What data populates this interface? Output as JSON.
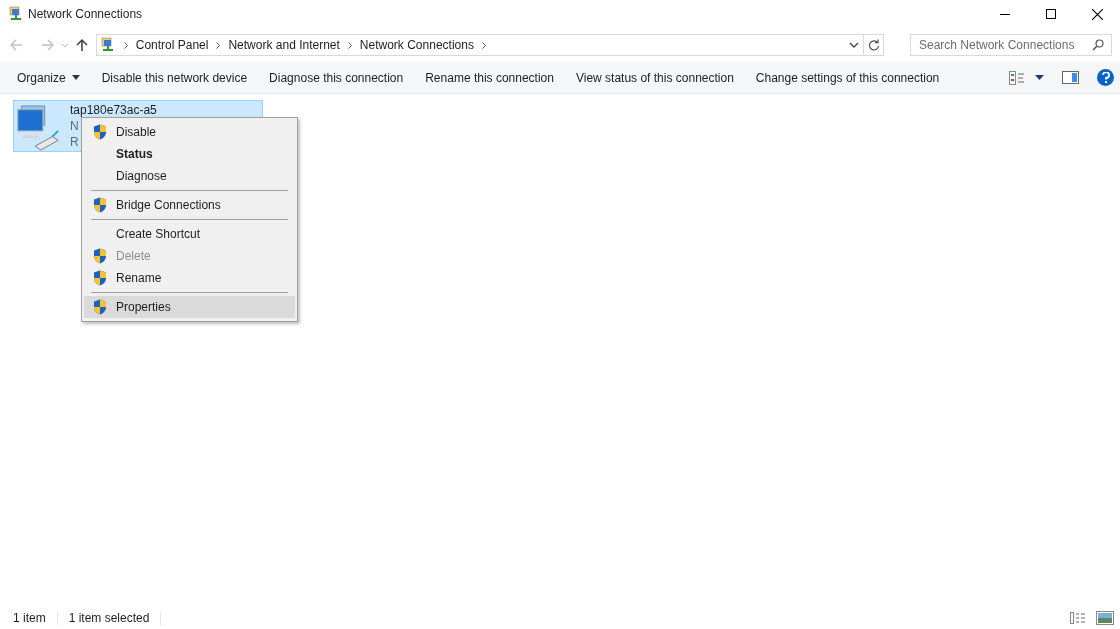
{
  "window": {
    "title": "Network Connections"
  },
  "address_bar": {
    "breadcrumbs": [
      "Control Panel",
      "Network and Internet",
      "Network Connections"
    ]
  },
  "search": {
    "placeholder": "Search Network Connections"
  },
  "toolbar": {
    "items": [
      {
        "label": "Organize",
        "dropdown": true
      },
      {
        "label": "Disable this network device",
        "dropdown": false
      },
      {
        "label": "Diagnose this connection",
        "dropdown": false
      },
      {
        "label": "Rename this connection",
        "dropdown": false
      },
      {
        "label": "View status of this connection",
        "dropdown": false
      },
      {
        "label": "Change settings of this connection",
        "dropdown": false
      }
    ]
  },
  "connection": {
    "name": "tap180e73ac-a5",
    "line_2": "N",
    "line_3": "R",
    "selected": true
  },
  "context_menu": {
    "items": [
      {
        "kind": "item",
        "label": "Disable",
        "shield": true,
        "bold": false,
        "disabled": false,
        "selected": false
      },
      {
        "kind": "item",
        "label": "Status",
        "shield": false,
        "bold": true,
        "disabled": false,
        "selected": false
      },
      {
        "kind": "item",
        "label": "Diagnose",
        "shield": false,
        "bold": false,
        "disabled": false,
        "selected": false
      },
      {
        "kind": "separator"
      },
      {
        "kind": "item",
        "label": "Bridge Connections",
        "shield": true,
        "bold": false,
        "disabled": false,
        "selected": false
      },
      {
        "kind": "separator"
      },
      {
        "kind": "item",
        "label": "Create Shortcut",
        "shield": false,
        "bold": false,
        "disabled": false,
        "selected": false
      },
      {
        "kind": "item",
        "label": "Delete",
        "shield": true,
        "bold": false,
        "disabled": true,
        "selected": false
      },
      {
        "kind": "item",
        "label": "Rename",
        "shield": true,
        "bold": false,
        "disabled": false,
        "selected": false
      },
      {
        "kind": "separator"
      },
      {
        "kind": "item",
        "label": "Properties",
        "shield": true,
        "bold": false,
        "disabled": false,
        "selected": true
      }
    ]
  },
  "status_bar": {
    "item_count": "1 item",
    "selection": "1 item selected"
  }
}
